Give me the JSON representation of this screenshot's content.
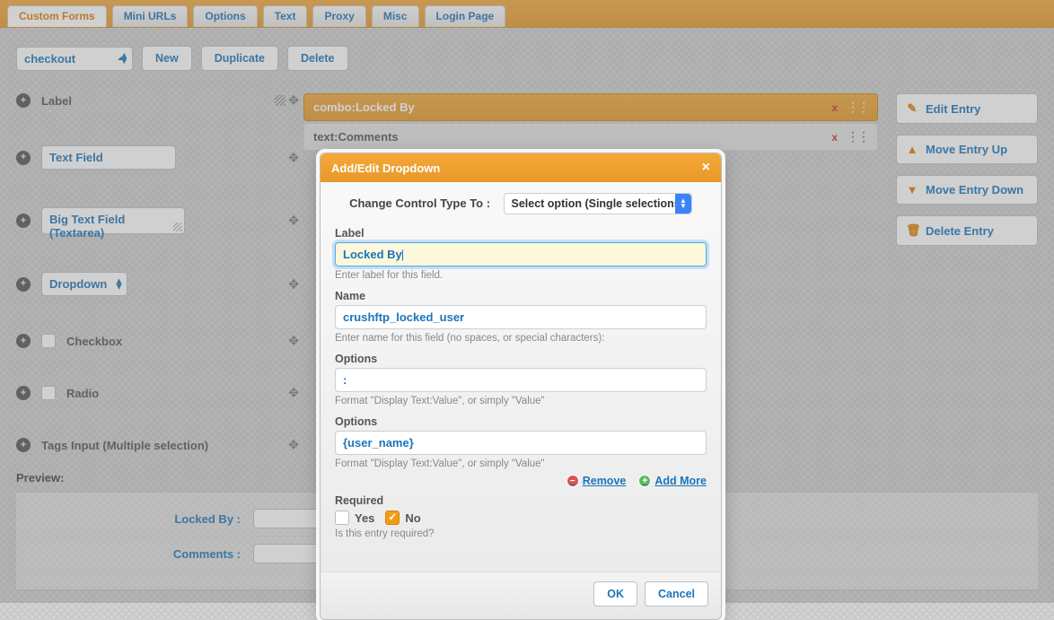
{
  "tabs": {
    "items": [
      {
        "label": "Custom Forms",
        "active": true
      },
      {
        "label": "Mini URLs",
        "active": false
      },
      {
        "label": "Options",
        "active": false
      },
      {
        "label": "Text",
        "active": false
      },
      {
        "label": "Proxy",
        "active": false
      },
      {
        "label": "Misc",
        "active": false
      },
      {
        "label": "Login Page",
        "active": false
      }
    ]
  },
  "toolbar": {
    "form_selected": "checkout",
    "new": "New",
    "duplicate": "Duplicate",
    "delete": "Delete"
  },
  "palette": {
    "label": "Label",
    "text_field": "Text Field",
    "big_text_field": "Big Text Field (Textarea)",
    "dropdown": "Dropdown",
    "checkbox": "Checkbox",
    "radio": "Radio",
    "tags_input": "Tags Input (Multiple selection)"
  },
  "entries": [
    {
      "text": "combo:Locked By",
      "selected": true
    },
    {
      "text": "text:Comments",
      "selected": false
    }
  ],
  "side": {
    "edit": "Edit Entry",
    "up": "Move Entry Up",
    "down": "Move Entry Down",
    "del": "Delete Entry"
  },
  "preview": {
    "heading": "Preview:",
    "rows": [
      {
        "label": "Locked By :"
      },
      {
        "label": "Comments :"
      }
    ]
  },
  "modal": {
    "title": "Add/Edit Dropdown",
    "change_type_label": "Change Control Type To :",
    "change_type_value": "Select option (Single selections)",
    "label_label": "Label",
    "label_value": "Locked By",
    "label_help": "Enter label for this field.",
    "name_label": "Name",
    "name_value": "crushftp_locked_user",
    "name_help": "Enter name for this field (no spaces, or special characters):",
    "options_label": "Options",
    "option1_value": ":",
    "options_help": "Format \"Display Text:Value\", or simply \"Value\"",
    "option2_value": "{user_name}",
    "remove": "Remove",
    "add_more": "Add More",
    "required_label": "Required",
    "yes": "Yes",
    "no": "No",
    "required_help": "Is this entry required?",
    "ok": "OK",
    "cancel": "Cancel"
  }
}
